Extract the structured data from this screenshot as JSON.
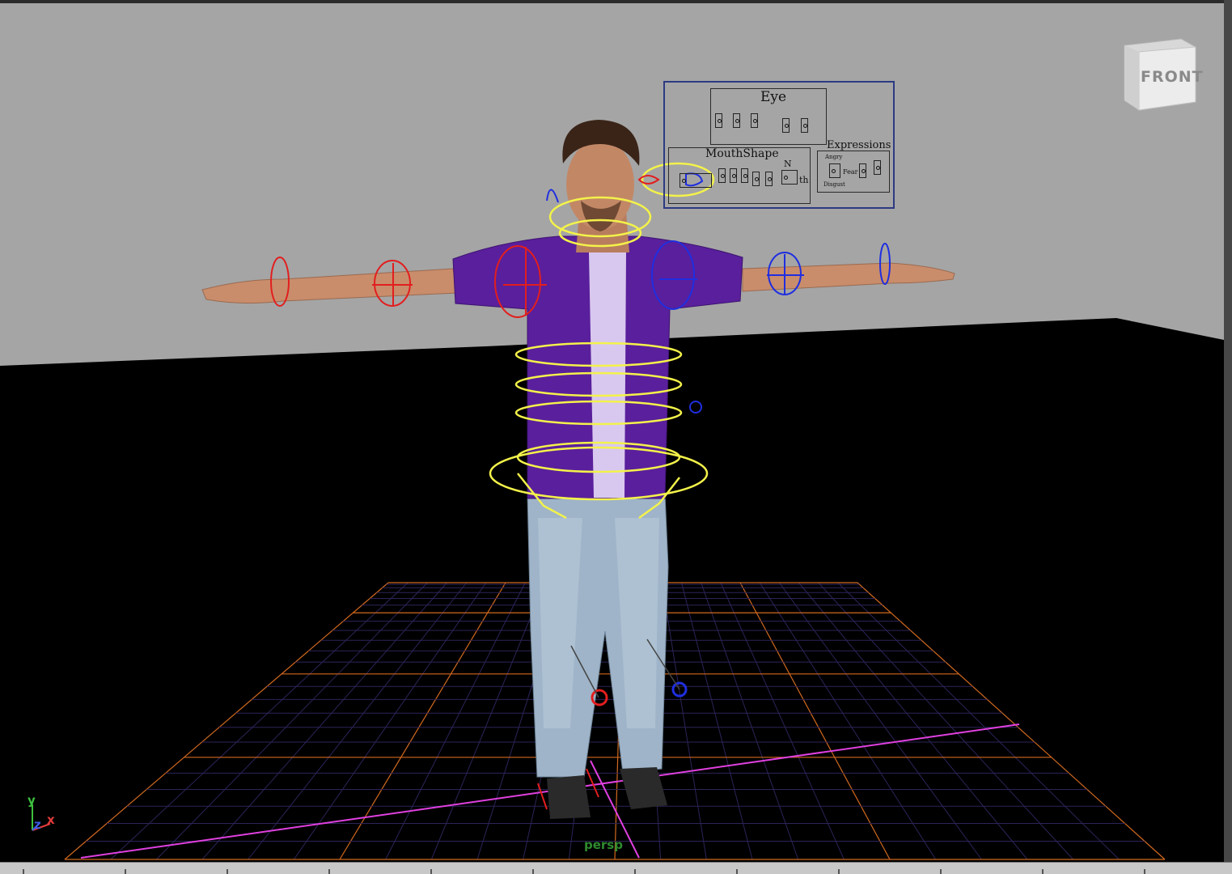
{
  "viewport": {
    "camera": "persp",
    "viewcube_face": "FRONT",
    "background_top": "#a4a4a4",
    "background_floor": "#000000"
  },
  "axis_gizmo": {
    "y": "y",
    "z": "z",
    "x": "x"
  },
  "facial_panel": {
    "eye_title": "Eye",
    "mouth_title": "MouthShape",
    "expr_title": "Expressions",
    "mouth_labels": [
      "N",
      "th"
    ],
    "expr_labels": [
      "Angry",
      "Fear",
      "Disgust"
    ]
  },
  "colors": {
    "ctrl_yellow": "#f3f24a",
    "ctrl_red": "#e21e1e",
    "ctrl_blue": "#1f2ee0",
    "grid_purple": "#2c2459",
    "grid_orange": "#d2691e",
    "grid_magenta": "#e040e0",
    "shirt": "#5a1f9c",
    "undershirt": "#d8c8ef",
    "jeans": "#9fb4c8",
    "skin": "#c98d6c"
  }
}
